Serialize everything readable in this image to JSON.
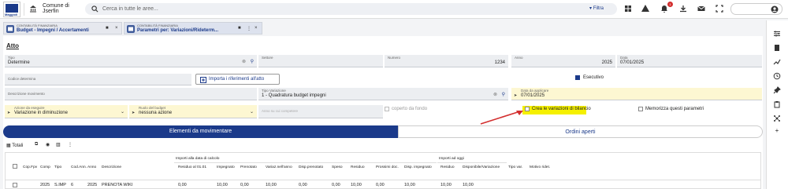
{
  "header": {
    "logo_text": "Maggioli",
    "comune_line1": "Comune di",
    "comune_line2": "Jserfin",
    "search_placeholder": "Cerca in tutte le aree...",
    "filtra": "Filtra",
    "notif_count": "1"
  },
  "tabs": [
    {
      "category": "CONTABILITÀ FINANZIARIA",
      "title": "Budget - Impegni / Accertamenti"
    },
    {
      "category": "CONTABILITÀ FINANZIARIA",
      "title": "Parametri per: Variazioni/Rideterm..."
    }
  ],
  "form": {
    "section_title": "Atto",
    "tipo": {
      "label": "Tipo",
      "value": "Determine"
    },
    "settore": {
      "label": "Settore",
      "value": ""
    },
    "numero": {
      "label": "Numero",
      "value": "1234"
    },
    "anno": {
      "label": "Anno",
      "value": "2025"
    },
    "data": {
      "label": "Data",
      "value": "07/01/2025"
    },
    "codice_determina": {
      "label": "Codice determina",
      "value": ""
    },
    "importa_button": "Importa i riferimenti all'atto",
    "esecutivo": "Esecutivo",
    "descrizione": {
      "label": "Descrizione movimento",
      "value": ""
    },
    "tipo_variazione": {
      "label": "Tipo Variazione",
      "value": "1 - Quadratura budget impegni"
    },
    "data_applicare": {
      "label": "Data da applicare",
      "value": "07/01/2025"
    },
    "azione": {
      "label": "Azione da eseguire",
      "value": "Variazione in diminuzione"
    },
    "ruolo": {
      "label": "Ruolo del budget",
      "value": "nessuna azione"
    },
    "anno_competenza": {
      "label": "Anno su cui competere",
      "value": ""
    },
    "coperto_fondo": "coperto da fondo",
    "crea_variazioni": "Crea le variazioni di bilancio",
    "memorizza": "Memorizza questi parametri"
  },
  "segments": {
    "active": "Elementi da movimentare",
    "inactive": "Ordini aperti"
  },
  "grid": {
    "totali": "Totali",
    "group1": "Importi alla data di calcolo",
    "group2": "Importi ad oggi",
    "columns": [
      "Cop.Fpv",
      "Comp",
      "Tipo",
      "Cod.Ann.",
      "Anno",
      "Descrizione",
      "Residuo al 01.01",
      "Impegnato",
      "Prenotato",
      "Variaz.nell'anno",
      "Disp.prenotato",
      "Speso",
      "Residuo",
      "Prossimi doc.",
      "Disp. impegnato",
      "Residuo",
      "Disponibile/Variazione",
      "Tipo var.",
      "Motivo ridet."
    ],
    "row": [
      "",
      "2025",
      "S.IMP",
      "6",
      "2025",
      "PRENOTA WIKI",
      "0,00",
      "10,00",
      "0,00",
      "10,00",
      "0,00",
      "0,00",
      "10,00",
      "0,00",
      "10,00",
      "10,00",
      "10,00",
      "",
      ""
    ]
  },
  "colors": {
    "brand": "#1b3a8a",
    "highlight": "#f5f000",
    "arrow": "#d32f2f"
  }
}
